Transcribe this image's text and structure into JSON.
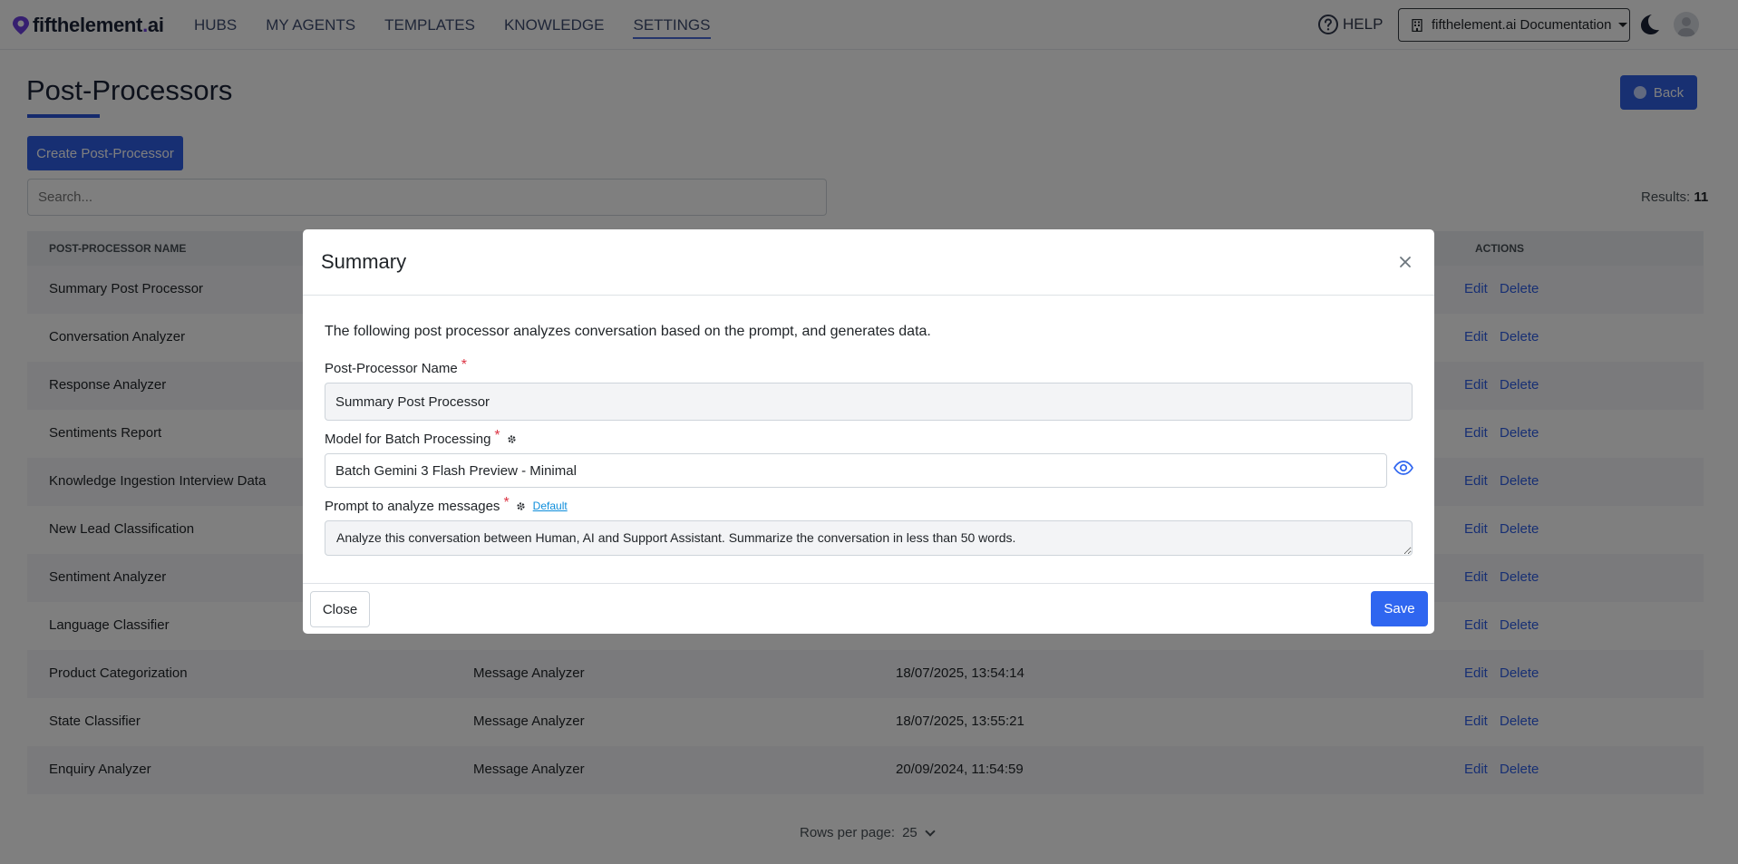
{
  "navbar": {
    "brand": "fifthelement",
    "brand_dot": ".",
    "brand_suffix": "ai",
    "links": [
      "HUBS",
      "MY AGENTS",
      "TEMPLATES",
      "KNOWLEDGE",
      "SETTINGS"
    ],
    "active_link": "SETTINGS",
    "help_label": "HELP",
    "docs_label": "fifthelement.ai Documentation"
  },
  "page": {
    "title": "Post-Processors",
    "back_label": "Back",
    "create_label": "Create Post-Processor",
    "search_placeholder": "Search...",
    "results_label": "Results:",
    "results_count": "11"
  },
  "table": {
    "headers": {
      "name": "POST-PROCESSOR NAME",
      "actions": "ACTIONS"
    },
    "edit_label": "Edit",
    "delete_label": "Delete",
    "rows": [
      {
        "name": "Summary Post Processor",
        "type": "",
        "date": ""
      },
      {
        "name": "Conversation Analyzer",
        "type": "",
        "date": ""
      },
      {
        "name": "Response Analyzer",
        "type": "",
        "date": ""
      },
      {
        "name": "Sentiments Report",
        "type": "",
        "date": ""
      },
      {
        "name": "Knowledge Ingestion Interview Data",
        "type": "",
        "date": ""
      },
      {
        "name": "New Lead Classification",
        "type": "",
        "date": ""
      },
      {
        "name": "Sentiment Analyzer",
        "type": "",
        "date": ""
      },
      {
        "name": "Language Classifier",
        "type": "",
        "date": ""
      },
      {
        "name": "Product Categorization",
        "type": "Message Analyzer",
        "date": "18/07/2025, 13:54:14"
      },
      {
        "name": "State Classifier",
        "type": "Message Analyzer",
        "date": "18/07/2025, 13:55:21"
      },
      {
        "name": "Enquiry Analyzer",
        "type": "Message Analyzer",
        "date": "20/09/2024, 11:54:59"
      }
    ],
    "rows_per_page_label": "Rows per page:",
    "rows_per_page_value": "25"
  },
  "modal": {
    "title": "Summary",
    "intro": "The following post processor analyzes conversation based on the prompt, and generates data.",
    "name_label": "Post-Processor Name",
    "name_value": "Summary Post Processor",
    "model_label": "Model for Batch Processing",
    "model_value": "Batch Gemini 3 Flash Preview - Minimal",
    "prompt_label": "Prompt to analyze messages",
    "default_link": "Default",
    "prompt_value": "Analyze this conversation between Human, AI and Support Assistant. Summarize the conversation in less than 50 words.",
    "required_mark": "*",
    "close_label": "Close",
    "save_label": "Save"
  },
  "colors": {
    "primary": "#2f66f0",
    "brand": "#6c3fe0",
    "required": "#dc3545",
    "link": "#0d8ddb"
  },
  "icons": [
    "brand-logo-icon",
    "help-icon",
    "building-icon",
    "moon-icon",
    "avatar-icon",
    "close-icon",
    "gear-icon",
    "eye-icon",
    "chevron-down-icon"
  ]
}
